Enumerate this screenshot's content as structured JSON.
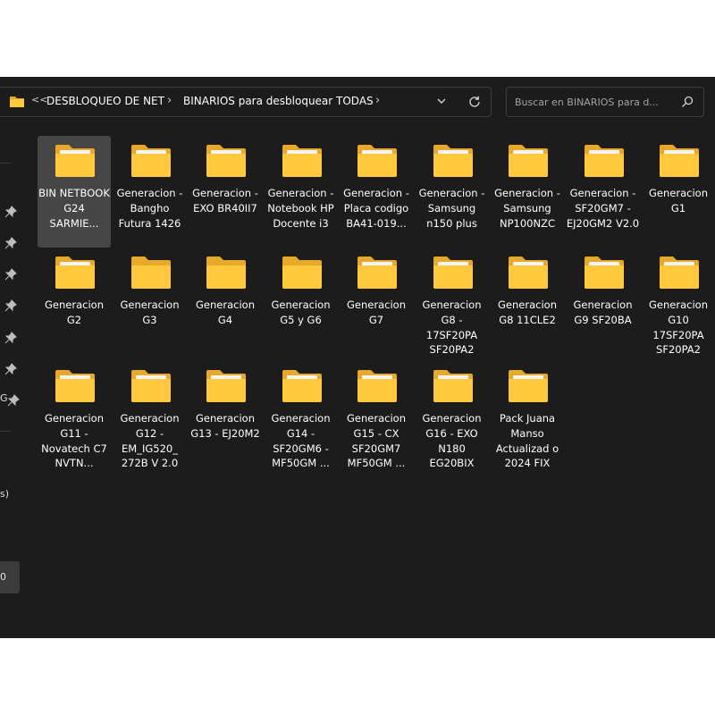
{
  "address": {
    "overflow_label": "<<",
    "crumbs": [
      "DESBLOQUEO DE NET",
      "BINARIOS para desbloquear TODAS"
    ],
    "dropdown_icon": "chevron-down-icon",
    "refresh_icon": "refresh-icon"
  },
  "search": {
    "placeholder": "Buscar en BINARIOS para d...",
    "icon": "search-icon"
  },
  "nav": {
    "cut_texts": [
      "G",
      "s)",
      "0"
    ]
  },
  "folders": [
    {
      "label": "BIN NETBOOK G24 SARMIE...",
      "selected": true,
      "has_content": true
    },
    {
      "label": "Generacion - Bangho Futura 1426",
      "has_content": true
    },
    {
      "label": "Generacion - EXO BR40II7",
      "has_content": true
    },
    {
      "label": "Generacion - Notebook HP Docente i3",
      "has_content": true
    },
    {
      "label": "Generacion - Placa codigo BA41-019...",
      "has_content": true
    },
    {
      "label": "Generacion - Samsung n150 plus",
      "has_content": true
    },
    {
      "label": "Generacion - Samsung NP100NZC",
      "has_content": true
    },
    {
      "label": "Generacion - SF20GM7 - EJ20GM2 V2.0",
      "has_content": true
    },
    {
      "label": "Generacion G1",
      "has_content": true
    },
    {
      "label": "Generacion G2",
      "has_content": true
    },
    {
      "label": "Generacion G3",
      "has_content": false
    },
    {
      "label": "Generacion G4",
      "has_content": false
    },
    {
      "label": "Generacion G5 y G6",
      "has_content": false
    },
    {
      "label": "Generacion G7",
      "has_content": true
    },
    {
      "label": "Generacion G8 - 17SF20PA SF20PA2",
      "has_content": true
    },
    {
      "label": "Generacion G8 11CLE2",
      "has_content": true
    },
    {
      "label": "Generacion G9 SF20BA",
      "has_content": true
    },
    {
      "label": "Generacion G10 17SF20PA SF20PA2",
      "has_content": true
    },
    {
      "label": "Generacion G11 - Novatech C7 NVTN...",
      "has_content": true
    },
    {
      "label": "Generacion G12 - EM_IG520_ 272B V 2.0",
      "has_content": true
    },
    {
      "label": "Generacion G13 - EJ20M2",
      "has_content": true
    },
    {
      "label": "Generacion G14 - SF20GM6 - MF50GM ...",
      "has_content": true
    },
    {
      "label": "Generacion G15 - CX SF20GM7 MF50GM ...",
      "has_content": true
    },
    {
      "label": "Generacion G16 - EXO N180 EG20BIX",
      "has_content": true
    },
    {
      "label": "Pack Juana Manso Actualizad o 2024 FIX",
      "has_content": true
    }
  ],
  "colors": {
    "window_bg": "#1c1c1c",
    "folder_back": "#e8a92a",
    "folder_front": "#ffc83d",
    "selected_tile": "#464646"
  }
}
